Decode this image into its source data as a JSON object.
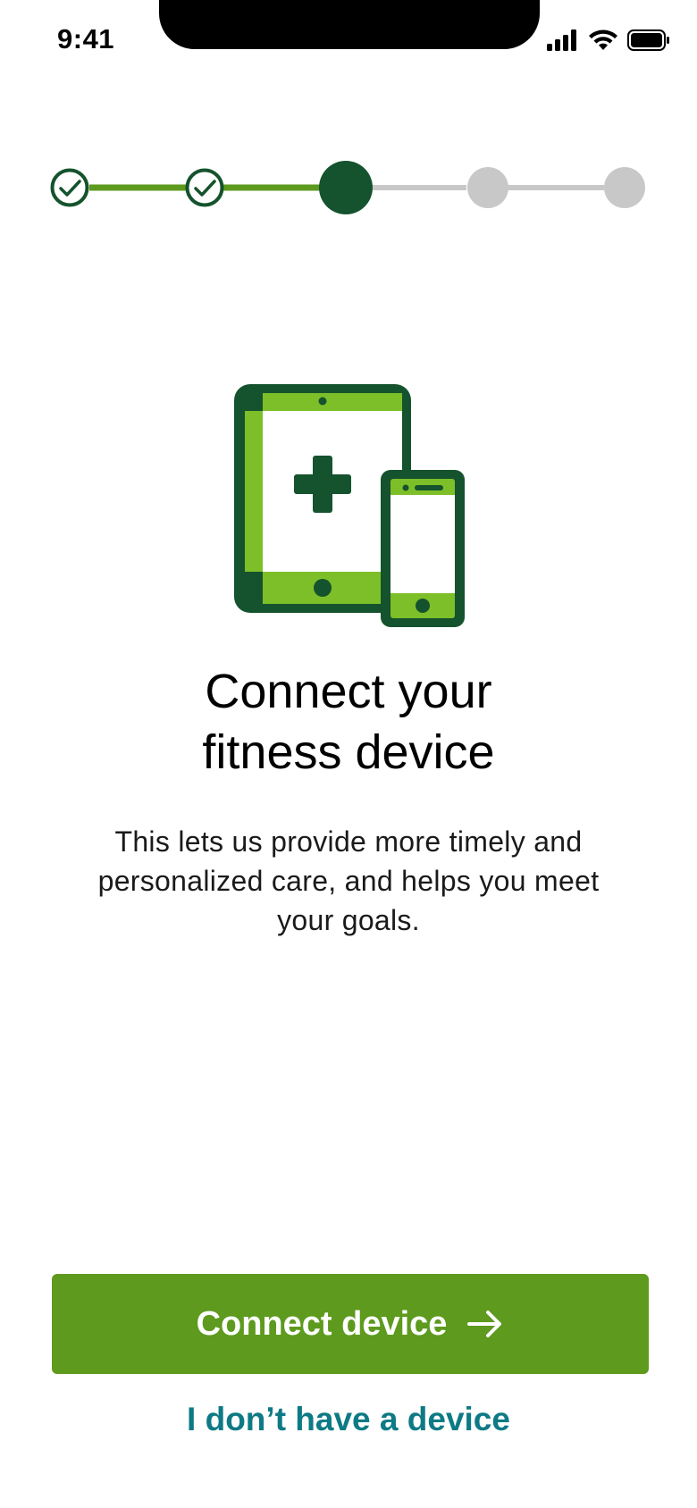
{
  "status_bar": {
    "time": "9:41",
    "icons": [
      "cellular-signal-icon",
      "wifi-icon",
      "battery-icon"
    ]
  },
  "stepper": {
    "total_steps": 5,
    "current_step": 3,
    "steps": [
      {
        "state": "complete",
        "icon": "check-icon"
      },
      {
        "state": "complete",
        "icon": "check-icon"
      },
      {
        "state": "current"
      },
      {
        "state": "upcoming"
      },
      {
        "state": "upcoming"
      }
    ]
  },
  "illustration": {
    "icon": "tablet-phone-health-icon"
  },
  "content": {
    "title_line1": "Connect your",
    "title_line2": "fitness device",
    "description": "This lets us provide more timely and personalized care, and helps you meet your goals."
  },
  "actions": {
    "primary_label": "Connect device",
    "primary_icon": "arrow-right-icon",
    "secondary_label": "I don’t have a device"
  },
  "colors": {
    "primary_green": "#5d9a1e",
    "dark_green": "#14532d",
    "light_green": "#7dbf28",
    "inactive_gray": "#c8c8c8",
    "link_teal": "#0e7a85"
  }
}
